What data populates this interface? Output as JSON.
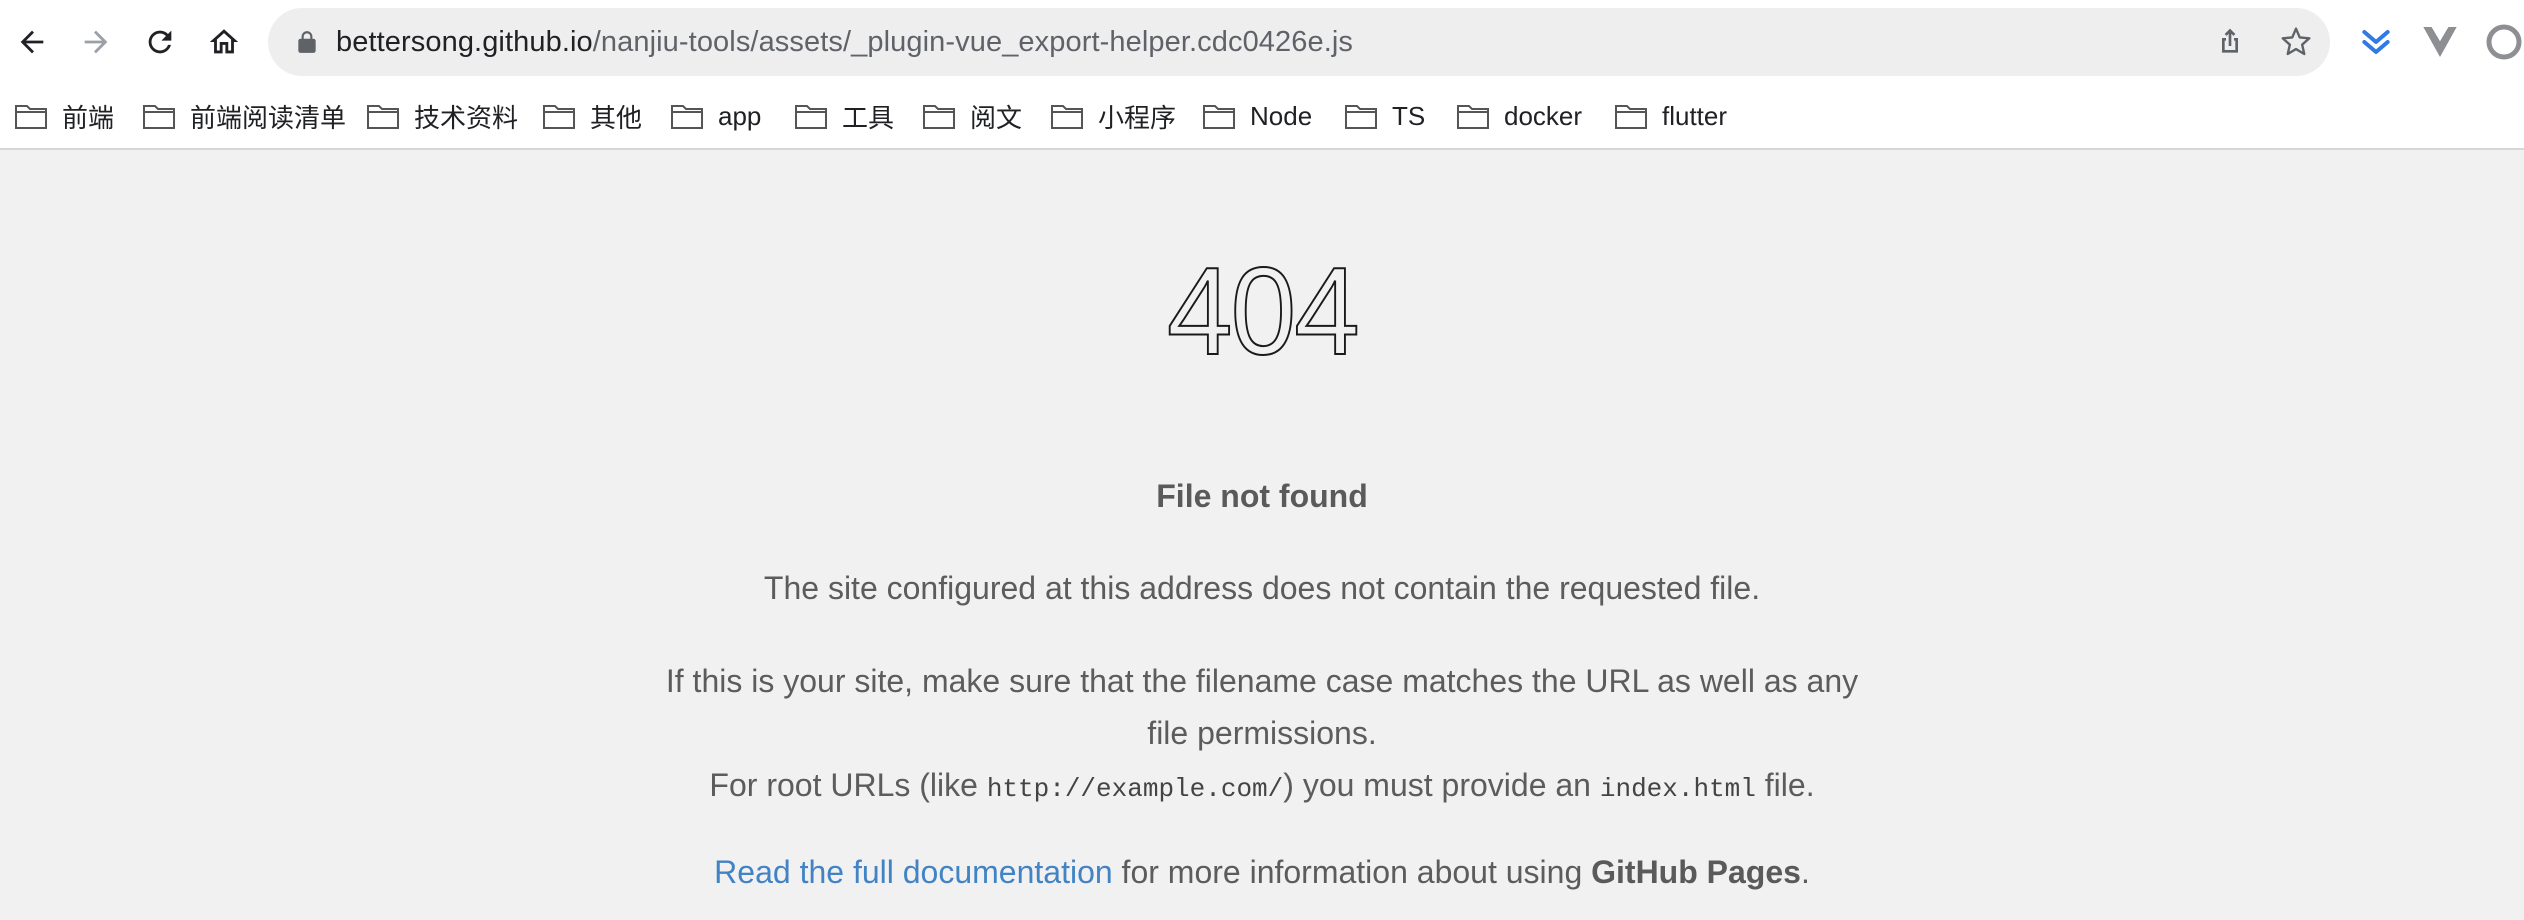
{
  "browser": {
    "url_host": "bettersong.github.io",
    "url_path": "/nanjiu-tools/assets/_plugin-vue_export-helper.cdc0426e.js",
    "accent_color": "#4183c4"
  },
  "bookmarks": [
    {
      "label": "前端"
    },
    {
      "label": "前端阅读清单"
    },
    {
      "label": "技术资料"
    },
    {
      "label": "其他"
    },
    {
      "label": "app"
    },
    {
      "label": "工具"
    },
    {
      "label": "阅文"
    },
    {
      "label": "小程序"
    },
    {
      "label": "Node"
    },
    {
      "label": "TS"
    },
    {
      "label": "docker"
    },
    {
      "label": "flutter"
    }
  ],
  "page": {
    "code": "404",
    "title": "File not found",
    "message": "The site configured at this address does not contain the requested file.",
    "hint_line1": "If this is your site, make sure that the filename case matches the URL as well as any",
    "hint_line2": "file permissions.",
    "root_prefix": "For root URLs (like ",
    "root_example": "http://example.com/",
    "root_middle": ") you must provide an ",
    "root_file": "index.html",
    "root_suffix": " file.",
    "doc_link": "Read the full documentation",
    "doc_middle": " for more information about using ",
    "doc_product": "GitHub Pages",
    "doc_end": "."
  }
}
